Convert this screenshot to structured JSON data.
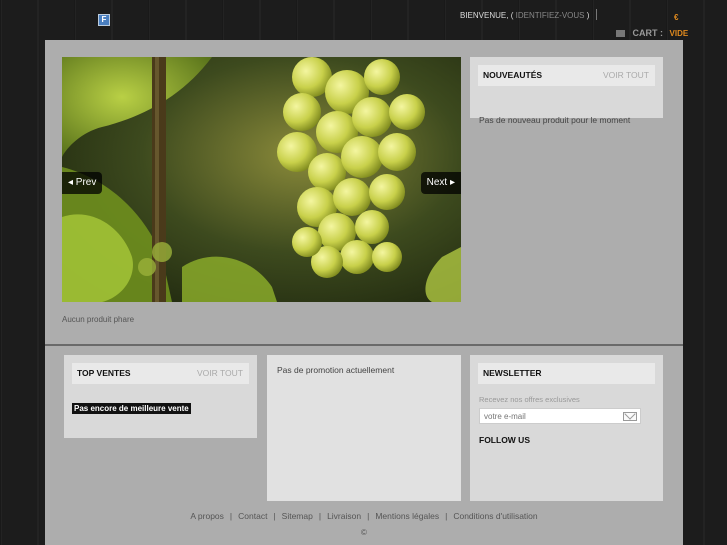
{
  "header": {
    "lang_flag": "F",
    "welcome": "BIENVENUE,",
    "login_open": "(",
    "login_link": "IDENTIFIEZ-VOUS",
    "login_close": ")",
    "currency": "€",
    "cart_label": "CART :",
    "cart_empty": "VIDE"
  },
  "slider": {
    "prev_label": "◂ Prev",
    "next_label": "Next ▸"
  },
  "featured": {
    "empty_text": "Aucun produit phare"
  },
  "nouveautes": {
    "title": "NOUVEAUTÉS",
    "see_all": "VOIR TOUT",
    "empty_text": "Pas de nouveau produit pour le moment"
  },
  "top_ventes": {
    "title": "TOP VENTES",
    "see_all": "VOIR TOUT",
    "empty_text": "Pas encore de meilleure vente"
  },
  "promo": {
    "empty_text": "Pas de promotion actuellement"
  },
  "newsletter": {
    "title": "NEWSLETTER",
    "subtitle": "Recevez nos offres exclusives",
    "placeholder": "votre e-mail",
    "follow_us": "FOLLOW US"
  },
  "footer": {
    "links": [
      "A propos",
      "Contact",
      "Sitemap",
      "Livraison",
      "Mentions légales",
      "Conditions d'utilisation"
    ],
    "separator": "|",
    "copyright": "©"
  },
  "colors": {
    "accent": "#e08a1e",
    "panel": "#adadad",
    "box": "#d9d9d9"
  },
  "icons": [
    "flag-icon",
    "cart-icon",
    "envelope-icon"
  ]
}
